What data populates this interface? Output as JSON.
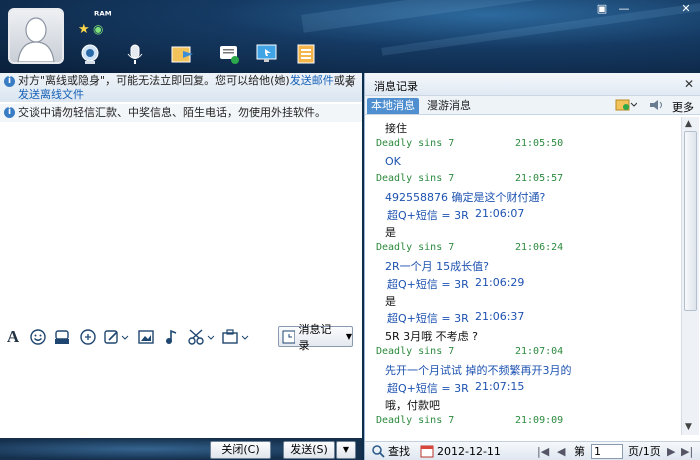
{
  "header": {
    "nickname": "ᴿᴬᴹ",
    "win_buttons": [
      "▣",
      "—",
      "✕"
    ]
  },
  "left": {
    "notice1": {
      "text_prefix": "对方\"离线或隐身\"，可能无法立即回复。您可以给他(她)",
      "link1": "发送邮件",
      "mid": "或者",
      "link2": "发送离线文件"
    },
    "notice2": "交谈中请勿轻信汇款、中奖信息、陌生电话，勿使用外挂软件。",
    "msg_record_label": "消息记录",
    "close_label": "关闭(C)",
    "send_label": "发送(S)"
  },
  "right": {
    "title": "消息记录",
    "tabs": [
      "本地消息",
      "漫游消息"
    ],
    "more_label": "更多",
    "messages": [
      {
        "kind": "text",
        "text": "接住",
        "color": "blk"
      },
      {
        "kind": "head",
        "sender": "Deadly sins 7",
        "time": "21:05:50"
      },
      {
        "kind": "text",
        "text": "OK",
        "color": "blue"
      },
      {
        "kind": "head",
        "sender": "Deadly sins 7",
        "time": "21:05:57"
      },
      {
        "kind": "text",
        "text": "492558876 确定是这个财付通?",
        "color": "blue"
      },
      {
        "kind": "sys",
        "sender": "超Q+短信 = 3R",
        "time": "21:06:07"
      },
      {
        "kind": "text",
        "text": "是",
        "color": "blk"
      },
      {
        "kind": "head",
        "sender": "Deadly sins 7",
        "time": "21:06:24"
      },
      {
        "kind": "text",
        "text": "2R一个月 15成长值?",
        "color": "blue"
      },
      {
        "kind": "sys",
        "sender": "超Q+短信 = 3R",
        "time": "21:06:29"
      },
      {
        "kind": "text",
        "text": "是",
        "color": "blk"
      },
      {
        "kind": "sys",
        "sender": "超Q+短信 = 3R",
        "time": "21:06:37"
      },
      {
        "kind": "text",
        "text": "5R 3月哦 不考虑 ?",
        "color": "blk"
      },
      {
        "kind": "head",
        "sender": "Deadly sins 7",
        "time": "21:07:04"
      },
      {
        "kind": "text",
        "text": "先开一个月试试  掉的不频繁再开3月的",
        "color": "blue"
      },
      {
        "kind": "sys",
        "sender": "超Q+短信 = 3R",
        "time": "21:07:15"
      },
      {
        "kind": "text",
        "text": "哦，付款吧",
        "color": "blk"
      },
      {
        "kind": "head",
        "sender": "Deadly sins 7",
        "time": "21:09:09"
      }
    ],
    "footer": {
      "search_label": "查找",
      "date": "2012-12-11",
      "page_prefix": "第",
      "page_value": "1",
      "page_suffix": "页/1页"
    }
  },
  "colors": {
    "accent": "#4f8fd0",
    "sender_green": "#2b8a3e",
    "msg_blue": "#1d52b0"
  }
}
